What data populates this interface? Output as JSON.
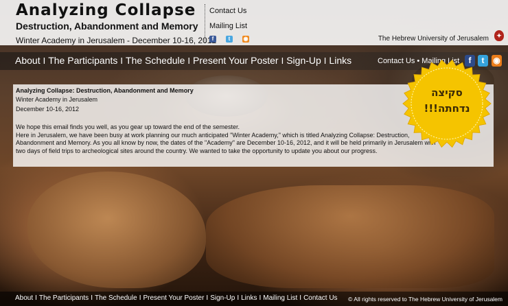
{
  "header": {
    "title": "Analyzing Collapse",
    "subtitle": "Destruction, Abandonment and Memory",
    "event_line": "Winter Academy in Jerusalem - December 10-16, 2012",
    "contact_label": "Contact Us",
    "mailing_label": "Mailing List",
    "university": "The Hebrew University of Jerusalem"
  },
  "nav": {
    "items": [
      "About",
      "The Participants",
      "The Schedule",
      "Present Your Poster",
      "Sign-Up",
      "Links"
    ],
    "separator": "I",
    "right_contact": "Contact Us",
    "right_mailing": "Mailing List",
    "dot": "•"
  },
  "content": {
    "title": "Analyzing Collapse: Destruction, Abandonment and Memory",
    "line2": "Winter Academy in Jerusalem",
    "line3": "December 10-16, 2012",
    "body": "We hope this email finds you well, as you gear up toward the end of the semester.\n Here in Jerusalem, we have been busy at work planning our much anticipated  \"Winter Academy,\" which is titled Analyzing Collapse: Destruction, Abandonment and Memory. As you all know by now, the dates of the \"Academy\" are December 10-16, 2012, and it will be held primarily in Jerusalem with two days of field trips to archeological sites around the country. We wanted to take the opportunity to update you about our progress."
  },
  "badge": {
    "line1": "סקיצה",
    "line2": "נדחתה!!!",
    "color": "#f5c400"
  },
  "footer": {
    "items": [
      "About",
      "The Participants",
      "The Schedule",
      "Present Your Poster",
      "Sign-Up",
      "Links",
      "Mailing List",
      "Contact Us"
    ],
    "separator": "I",
    "copyright": "© All rights reserved to The Hebrew University of Jerusalem"
  },
  "icons": {
    "facebook": "f",
    "twitter": "t",
    "rss": "rss"
  }
}
